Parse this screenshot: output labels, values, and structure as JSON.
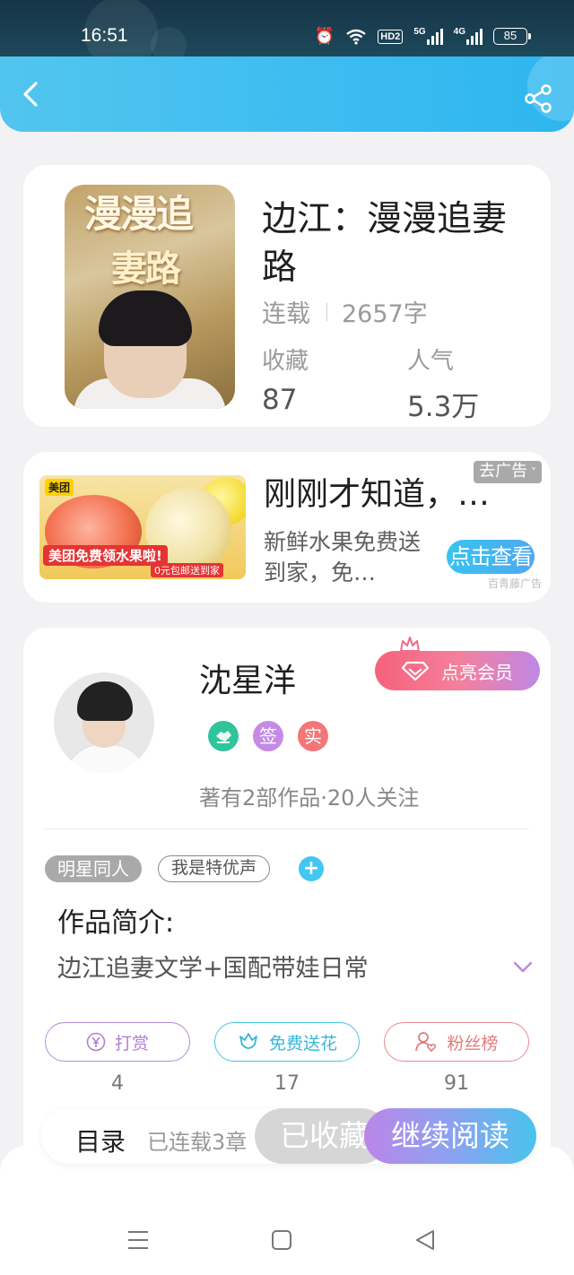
{
  "status_bar": {
    "time": "16:51",
    "hd_label": "HD2",
    "signal1_label": "5G",
    "signal2_label": "4G",
    "battery": "85"
  },
  "book": {
    "title": "边江：漫漫追妻路",
    "status": "连载",
    "word_count": "2657字",
    "favorites_label": "收藏",
    "favorites_value": "87",
    "popularity_label": "人气",
    "popularity_value": "5.3万",
    "cover": {
      "title_line1": "漫漫追",
      "title_line2": "妻路"
    }
  },
  "ad": {
    "title": "刚刚才知道，…",
    "description": "新鲜水果免费送到家，免…",
    "close_label": "去广告",
    "button_label": "点击查看",
    "source": "百青藤广告",
    "image": {
      "logo": "美团",
      "headline": "美团免费领水果啦!",
      "subline": "0元包邮送到家"
    }
  },
  "author": {
    "name": "沈星洋",
    "vip_label": "点亮会员",
    "badges": [
      "签",
      "实"
    ],
    "stats": "著有2部作品·20人关注"
  },
  "tags": [
    "明星同人",
    "我是特优声"
  ],
  "intro": {
    "heading": "作品简介:",
    "text": "边江追妻文学+国配带娃日常"
  },
  "actions": [
    {
      "label": "打赏",
      "count": "4"
    },
    {
      "label": "免费送花",
      "count": "17"
    },
    {
      "label": "粉丝榜",
      "count": "91"
    }
  ],
  "bottom": {
    "catalog": "目录",
    "chapters": "已连载3章",
    "favorite": "已收藏",
    "continue": "继续阅读"
  },
  "colors": {
    "header": "#3fbdf0",
    "accent_blue": "#43c6f0",
    "vip_pink": "#f5617a",
    "reward_purple": "#b07ed3",
    "fans_red": "#e27b7b"
  }
}
